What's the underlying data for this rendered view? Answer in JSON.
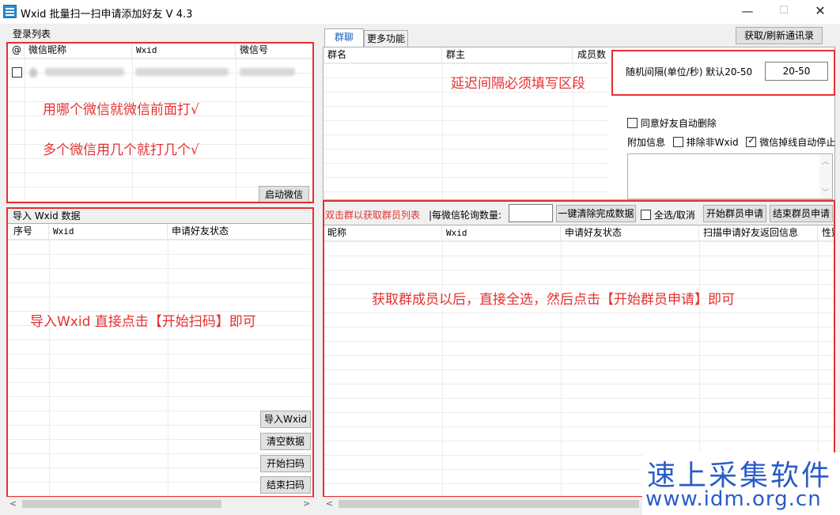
{
  "window": {
    "title": "Wxid 批量扫一扫申请添加好友 V 4.3",
    "min_icon": "—",
    "max_icon": "☐",
    "close_icon": "✕"
  },
  "login_list": {
    "group_label": "登录列表",
    "columns": [
      "@",
      "微信昵称",
      "Wxid",
      "微信号"
    ],
    "start_button": "启动微信",
    "annotation_1": "用哪个微信就微信前面打√",
    "annotation_2": "多个微信用几个就打几个√"
  },
  "import_panel": {
    "group_label": "导入 Wxid 数据",
    "columns": [
      "序号",
      "Wxid",
      "申请好友状态"
    ],
    "annotation": "导入Wxid 直接点击【开始扫码】即可",
    "buttons": {
      "import": "导入Wxid",
      "clear": "清空数据",
      "start": "开始扫码",
      "stop": "结束扫码"
    }
  },
  "tabs": {
    "group_chat": "群聊",
    "more": "更多功能"
  },
  "refresh_button": "获取/刷新通讯录",
  "group_table": {
    "columns": [
      "群名",
      "群主",
      "成员数"
    ]
  },
  "interval": {
    "label": "随机间隔(单位/秒) 默认20-50",
    "value": "20-50",
    "annotation": "延迟间隔必须填写区段"
  },
  "options": {
    "auto_delete": "同意好友自动删除",
    "extra_info": "附加信息",
    "exclude_non_wxid": "排除非Wxid",
    "auto_stop": "微信掉线自动停止"
  },
  "member_toolbar": {
    "hint": "双击群以获取群员列表",
    "poll_label": "|每微信轮询数量:",
    "clear_done": "一键清除完成数据",
    "select_all": "全选/取消",
    "start_apply": "开始群员申请",
    "stop_apply": "结束群员申请"
  },
  "member_table": {
    "columns": [
      "昵称",
      "Wxid",
      "申请好友状态",
      "扫描申请好友返回信息",
      "性别"
    ],
    "annotation": "获取群成员以后，直接全选，然后点击【开始群员申请】即可"
  },
  "watermark": {
    "brand": "速上采集软件",
    "url": "www.idm.org.cn"
  },
  "colors": {
    "annotation_red": "#e53030",
    "tab_blue": "#1a5fb4",
    "watermark_blue": "#2a5cc8"
  }
}
